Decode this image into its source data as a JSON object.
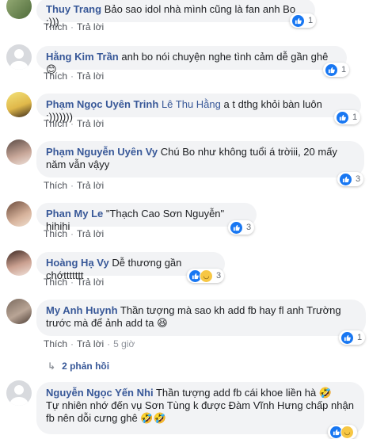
{
  "actions": {
    "like": "Thích",
    "reply": "Trả lời",
    "sep": "·"
  },
  "comments": [
    {
      "name": "Thuy Trang",
      "text": "Bảo sao idol nhà mình cũng là fan anh Bo :)))",
      "reactions": "1",
      "time": ""
    },
    {
      "name": "Hằng Kim Trần",
      "text": "anh bo nói chuyện nghe tình cảm dễ gần ghê 😊",
      "reactions": "1",
      "time": ""
    },
    {
      "name": "Phạm Ngọc Uyên Trinh",
      "tag": "Lê Thu Hằng",
      "text": "a t dthg khỏi bàn luôn :)))))))",
      "reactions": "1",
      "time": ""
    },
    {
      "name": "Phạm Nguyễn Uyên Vy",
      "text_line1": "Chú Bo như không tuổi á trờiii, 20 mấy",
      "text_line2": "năm vẫn vậyy",
      "reactions": "3",
      "time": ""
    },
    {
      "name": "Phan My Le",
      "text": "\"Thạch Cao Sơn Nguyễn\" hihihi",
      "reactions": "3",
      "time": ""
    },
    {
      "name": "Hoàng Hạ Vy",
      "text": "Dễ thương gần chớttttttt",
      "reactions": "3",
      "time": ""
    },
    {
      "name": "My Anh Huynh",
      "text_line1": "Thần tượng mà sao kh add fb hay fl anh Trường",
      "text_line2": "trước mà để ảnh add ta 😆",
      "reactions": "1",
      "time": "5 giờ",
      "replies": "2 phản hồi"
    },
    {
      "name": "Nguyễn Ngọc Yến Nhi",
      "text_line1": "Thần tượng add fb cái khoe liền hà 🤣",
      "text_line2": "Tự nhiên nhớ đến vụ Sơn Tùng k được Đàm Vĩnh Hưng chấp nhận",
      "text_line3": "fb nên dỗi cưng ghê 🤣🤣",
      "reactions": "",
      "time": ""
    }
  ],
  "colors": {
    "link": "#385898",
    "bubble": "#f2f3f5",
    "like": "#1877f2",
    "haha": "#f7c744"
  }
}
